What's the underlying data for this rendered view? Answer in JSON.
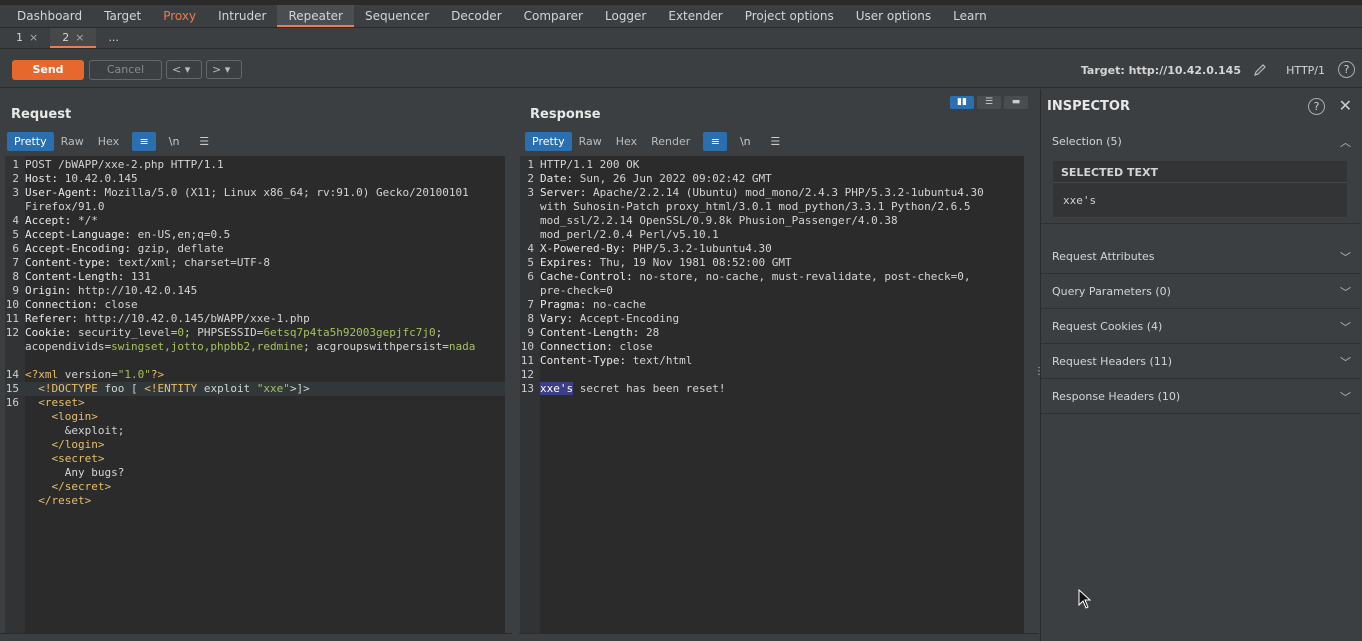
{
  "main_tabs": [
    "Dashboard",
    "Target",
    "Proxy",
    "Intruder",
    "Repeater",
    "Sequencer",
    "Decoder",
    "Comparer",
    "Logger",
    "Extender",
    "Project options",
    "User options",
    "Learn"
  ],
  "sub_tabs": [
    {
      "label": "1",
      "close": "×"
    },
    {
      "label": "2",
      "close": "×"
    },
    {
      "label": "...",
      "close": ""
    }
  ],
  "toolbar": {
    "send": "Send",
    "cancel": "Cancel",
    "back": "<",
    "forward": ">",
    "dropdown": "▾",
    "target": "Target: http://10.42.0.145",
    "protocol": "HTTP/1",
    "help": "?"
  },
  "request": {
    "title": "Request",
    "view_tabs": [
      "Pretty",
      "Raw",
      "Hex"
    ],
    "wrap_icon": "≡",
    "newline_icon": "\\n",
    "menu_icon": "☰"
  },
  "response": {
    "title": "Response",
    "view_tabs": [
      "Pretty",
      "Raw",
      "Hex",
      "Render"
    ],
    "wrap_icon": "≡",
    "newline_icon": "\\n",
    "menu_icon": "☰"
  },
  "inspector": {
    "title": "INSPECTOR",
    "help": "?",
    "close": "✕",
    "selection": "Selection (5)",
    "selected_text_label": "SELECTED TEXT",
    "selected_text": "xxe's",
    "sections": [
      "Request Attributes",
      "Query Parameters (0)",
      "Request Cookies (4)",
      "Request Headers (11)",
      "Response Headers (10)"
    ]
  },
  "colors": {
    "accent": "#f37a44",
    "send": "#e8672d",
    "active_blue": "#2a6fb0",
    "selection": "#3d3f86"
  }
}
